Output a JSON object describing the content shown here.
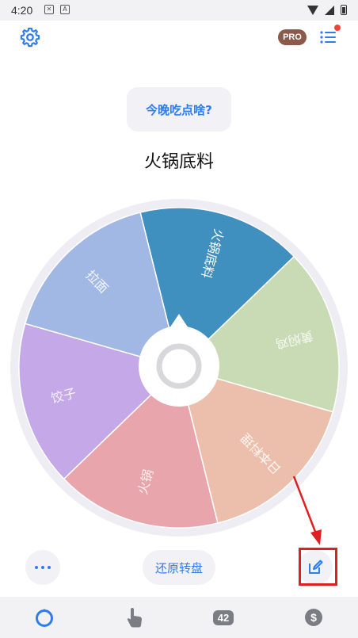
{
  "status_bar": {
    "time": "4:20",
    "icons": [
      "shield-icon",
      "a-icon",
      "wifi-icon",
      "signal-icon",
      "battery-icon"
    ]
  },
  "header": {
    "pro_label": "PRO",
    "icons": [
      "gear-icon",
      "list-icon"
    ]
  },
  "question": {
    "label": "今晚吃点啥?"
  },
  "result": {
    "text": "火锅底料"
  },
  "wheel": {
    "segments": [
      {
        "label": "火锅底料",
        "color": "#3f8fbf"
      },
      {
        "label": "黄焖鸡",
        "color": "#c8dbb4"
      },
      {
        "label": "日本料理",
        "color": "#ecbfac"
      },
      {
        "label": "火锅",
        "color": "#e8a5ab"
      },
      {
        "label": "饺子",
        "color": "#c4a8e8"
      },
      {
        "label": "拉面",
        "color": "#a2b8e4"
      }
    ]
  },
  "actions": {
    "reset_label": "还原转盘",
    "icons": [
      "more-icon",
      "edit-icon"
    ]
  },
  "bottom_nav": {
    "badge_count": "42",
    "icons": [
      "wheel-icon",
      "tap-icon",
      "count-icon",
      "dollar-icon"
    ],
    "dollar_symbol": "$"
  },
  "colors": {
    "accent": "#2e7cf0",
    "annotation": "#e02020",
    "pro_badge": "#8a5a4a"
  }
}
